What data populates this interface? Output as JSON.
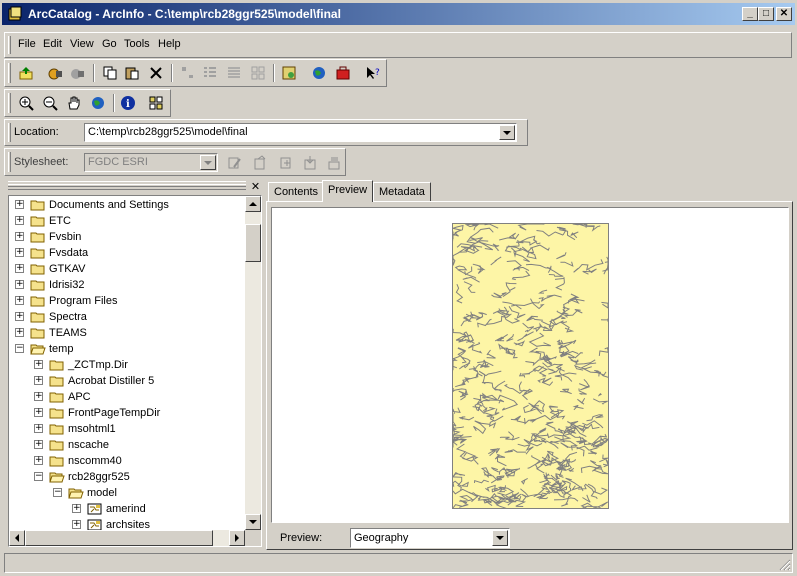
{
  "window": {
    "title": "ArcCatalog - ArcInfo - C:\\temp\\rcb28ggr525\\model\\final",
    "min": "_",
    "max": "□",
    "close": "✕"
  },
  "menu": [
    "File",
    "Edit",
    "View",
    "Go",
    "Tools",
    "Help"
  ],
  "location": {
    "label": "Location:",
    "value": "C:\\temp\\rcb28ggr525\\model\\final"
  },
  "stylesheet": {
    "label": "Stylesheet:",
    "value": "FGDC ESRI"
  },
  "tabs": [
    "Contents",
    "Preview",
    "Metadata"
  ],
  "active_tab": "Preview",
  "tree": [
    {
      "label": "Documents and Settings",
      "expanded": false
    },
    {
      "label": "ETC",
      "expanded": false
    },
    {
      "label": "Fvsbin",
      "expanded": false
    },
    {
      "label": "Fvsdata",
      "expanded": false
    },
    {
      "label": "GTKAV",
      "expanded": false
    },
    {
      "label": "Idrisi32",
      "expanded": false
    },
    {
      "label": "Program Files",
      "expanded": false
    },
    {
      "label": "Spectra",
      "expanded": false
    },
    {
      "label": "TEAMS",
      "expanded": false
    },
    {
      "label": "temp",
      "expanded": true
    },
    {
      "label": "_ZCTmp.Dir",
      "expanded": false
    },
    {
      "label": "Acrobat Distiller 5",
      "expanded": false
    },
    {
      "label": "APC",
      "expanded": false
    },
    {
      "label": "FrontPageTempDir",
      "expanded": false
    },
    {
      "label": "msohtml1",
      "expanded": false
    },
    {
      "label": "nscache",
      "expanded": false
    },
    {
      "label": "nscomm40",
      "expanded": false
    },
    {
      "label": "rcb28ggr525",
      "expanded": true
    },
    {
      "label": "model",
      "expanded": true
    },
    {
      "label": "amerind",
      "expanded": false
    },
    {
      "label": "archsites",
      "expanded": false
    }
  ],
  "preview": {
    "label": "Preview:",
    "value": "Geography"
  },
  "colors": {
    "map_fill": "#fdf5a6",
    "map_line": "#808080",
    "title_start": "#0a246a",
    "title_end": "#a6caf0"
  }
}
